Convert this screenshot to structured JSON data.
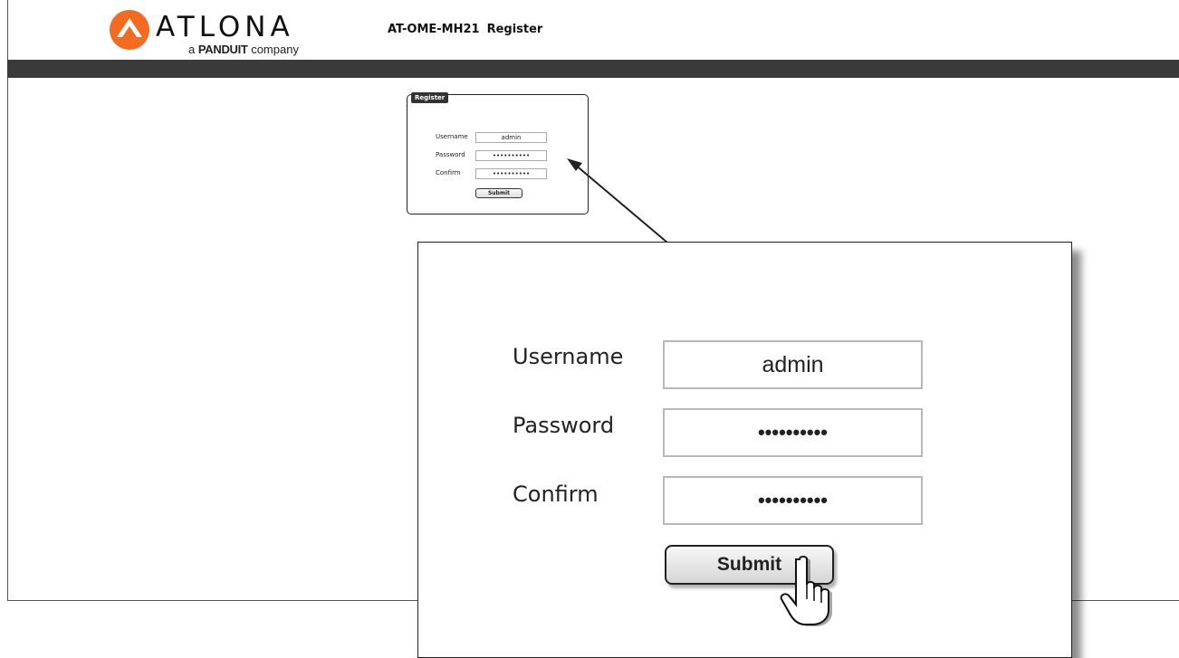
{
  "brand": {
    "wordmark": "ATLONA",
    "tagline_prefix": "a",
    "tagline_brand": "PANDUIT",
    "tagline_suffix": "company",
    "accent": "#f26b21"
  },
  "header": {
    "model": "AT-OME-MH21",
    "page": "Register",
    "bar_color": "#3a3a3a"
  },
  "register": {
    "legend": "Register",
    "username_label": "Username",
    "username_value": "admin",
    "password_label": "Password",
    "password_value": "••••••••••",
    "confirm_label": "Confirm",
    "confirm_value": "••••••••••",
    "submit_label": "Submit"
  },
  "icons": {
    "logo": "atlona-logo-icon",
    "pointer": "hand-pointer-icon"
  }
}
